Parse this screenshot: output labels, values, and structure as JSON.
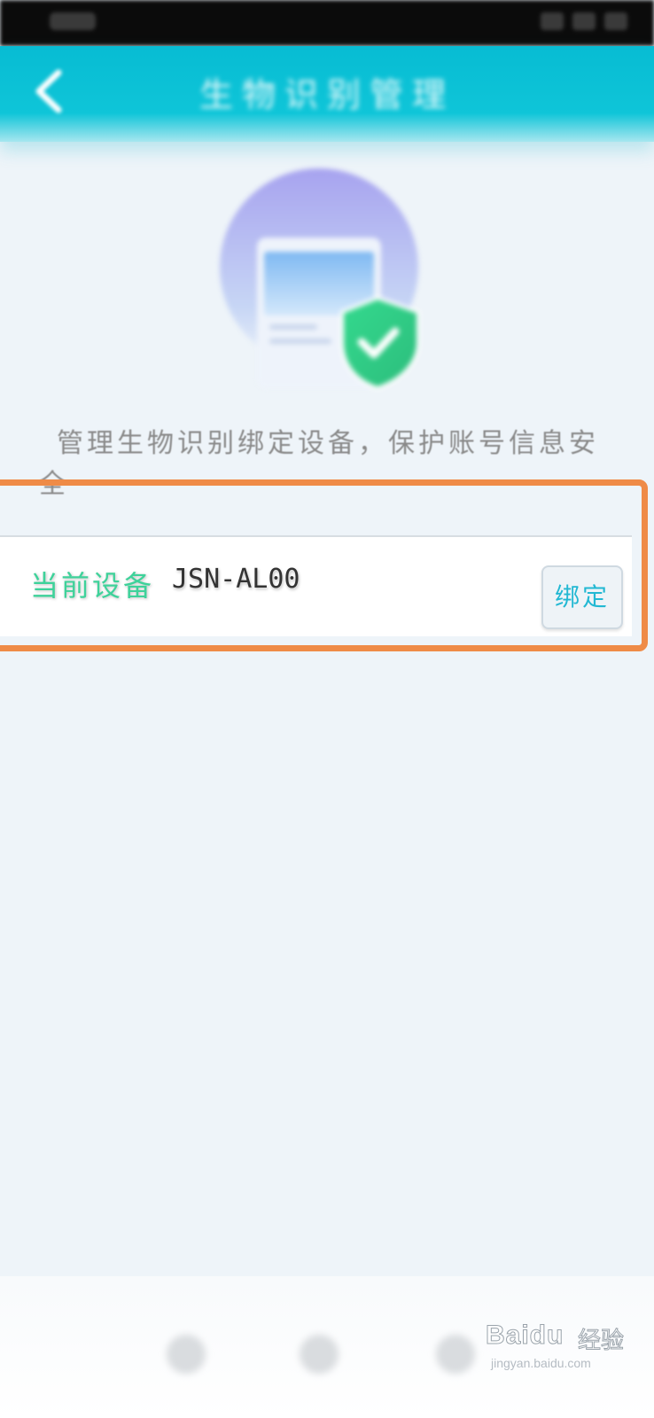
{
  "header": {
    "title": "生物识别管理"
  },
  "description": "管理生物识别绑定设备，保护账号信息安全",
  "device": {
    "label": "当前设备",
    "name": "JSN-AL00",
    "bind_label": "绑定"
  },
  "watermark": {
    "brand": "Baidu",
    "brand_cn": "经验",
    "url": "jingyan.baidu.com"
  },
  "colors": {
    "header": "#0fc5d8",
    "device_label": "#3ed29a",
    "bind_text": "#22b8d3",
    "highlight_border": "#ef8b47"
  }
}
